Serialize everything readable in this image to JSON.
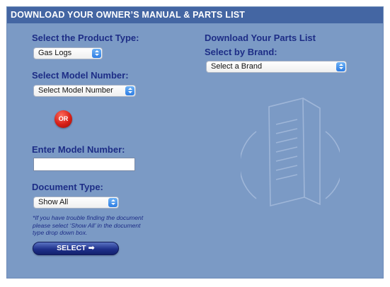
{
  "header": {
    "title": "DOWNLOAD YOUR OWNER’S MANUAL & PARTS LIST"
  },
  "left": {
    "product_type_label": "Select the Product Type:",
    "product_type_value": "Gas Logs",
    "model_number_label": "Select Model Number:",
    "model_number_value": "Select Model Number",
    "or_label": "OR",
    "enter_model_label": "Enter Model Number:",
    "enter_model_value": "",
    "document_type_label": "Document Type:",
    "document_type_value": "Show All",
    "note_lines": [
      "*If you have trouble finding the document",
      "please select ‘Show All’ in the document",
      "type drop down box."
    ],
    "select_button_label": "SELECT",
    "select_button_arrow": "➡"
  },
  "right": {
    "parts_list_label": "Download Your Parts List",
    "brand_label": "Select by Brand:",
    "brand_value": "Select a Brand"
  },
  "colors": {
    "panel_bg": "#7b9ac5",
    "header_bg": "#4466a3",
    "label_text": "#1d2d86",
    "accent_blue": "#2e7de3",
    "or_red": "#d61f17"
  },
  "icons": {
    "select_arrow": "chevron-updown-icon",
    "watermark": "document-brochure-icon",
    "button_arrow": "arrow-right-icon"
  }
}
